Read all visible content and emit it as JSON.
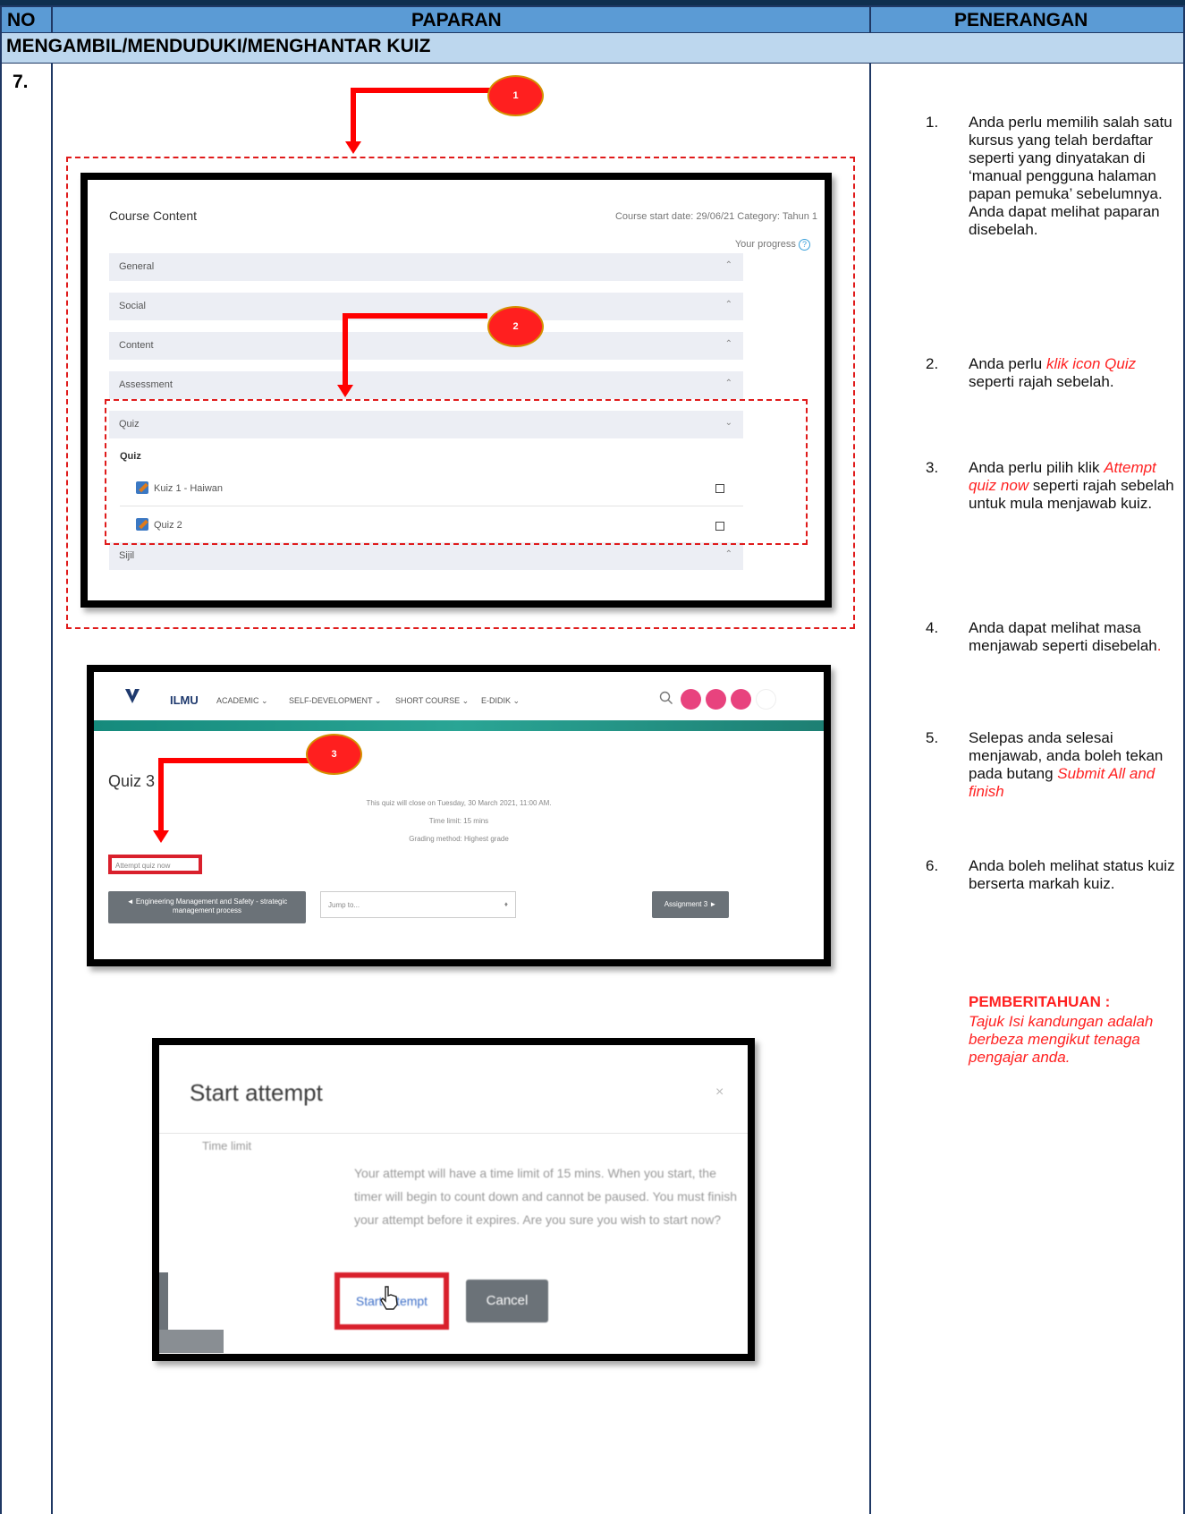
{
  "table": {
    "header": {
      "no": "NO",
      "paparan": "PAPARAN",
      "penerangan": "PENERANGAN"
    },
    "section_title": "MENGAMBIL/MENDUDUKI/MENGHANTAR KUIZ",
    "row_number": "7."
  },
  "shot1": {
    "title": "Course Content",
    "meta": "Course start date: 29/06/21   Category: Tahun 1",
    "progress": "Your progress",
    "sections": [
      "General",
      "Social",
      "Content",
      "Assessment",
      "Quiz",
      "Sijil"
    ],
    "quiz_heading": "Quiz",
    "quiz_items": [
      "Kuiz 1 - Haiwan",
      "Quiz 2"
    ],
    "badge1": "1",
    "badge2": "2"
  },
  "shot2": {
    "brand": "ILMU",
    "nav": [
      "ACADEMIC ⌄",
      "SELF-DEVELOPMENT ⌄",
      "SHORT COURSE ⌄",
      "E-DIDIK ⌄"
    ],
    "quiz_title": "Quiz 3",
    "info": [
      "This quiz will close on Tuesday, 30 March 2021, 11:00 AM.",
      "Time limit: 15 mins",
      "Grading method: Highest grade"
    ],
    "attempt_button": "Attempt quiz now",
    "prev_button": "◄ Engineering Management and Safety - strategic management process",
    "jump_placeholder": "Jump to...",
    "next_button": "Assignment 3 ►",
    "badge3": "3"
  },
  "shot3": {
    "title": "Start attempt",
    "close": "×",
    "label": "Time limit",
    "body": "Your attempt will have a time limit of 15 mins. When you start, the timer will begin to count down and cannot be paused. You must finish your attempt before it expires. Are you sure you wish to start now?",
    "start_button": "Start attempt",
    "cancel_button": "Cancel"
  },
  "steps": {
    "s1": {
      "num": "1.",
      "text": "Anda perlu memilih salah satu kursus yang telah berdaftar seperti yang dinyatakan di ‘manual pengguna halaman papan pemuka’ sebelumnya. Anda dapat melihat paparan disebelah."
    },
    "s2": {
      "num": "2.",
      "pre": "Anda perlu ",
      "red": "klik icon Quiz",
      "post": " seperti rajah sebelah."
    },
    "s3": {
      "num": "3.",
      "pre": "Anda perlu pilih klik ",
      "red": "Attempt quiz now",
      "post": " seperti rajah sebelah untuk mula menjawab kuiz."
    },
    "s4": {
      "num": "4.",
      "text": "Anda dapat melihat masa menjawab seperti disebelah",
      "dot": "."
    },
    "s5": {
      "num": "5.",
      "pre": "Selepas anda selesai menjawab, anda boleh tekan pada butang ",
      "red": "Submit All and finish"
    },
    "s6": {
      "num": "6.",
      "text": "Anda boleh melihat status kuiz berserta markah kuiz."
    },
    "notice_title": "PEMBERITAHUAN :",
    "notice_text": "Tajuk Isi kandungan adalah berbeza mengikut tenaga pengajar anda."
  },
  "colors": {
    "header_blue": "#5b9bd5",
    "section_blue": "#bdd7ee",
    "annotation_red": "#ff0000",
    "navy": "#1f3864"
  }
}
